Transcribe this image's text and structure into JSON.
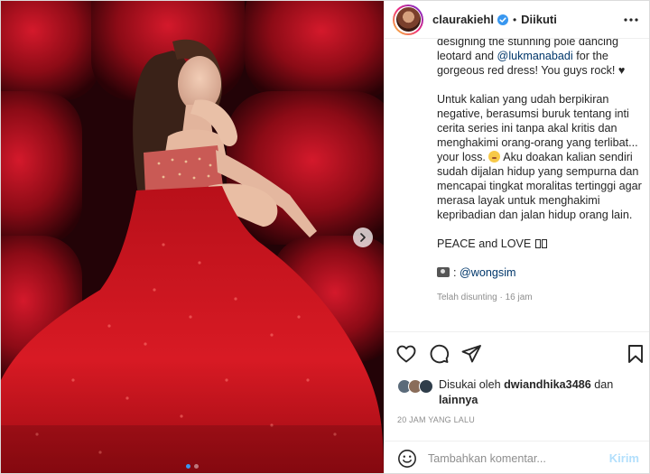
{
  "header": {
    "username": "claurakiehl",
    "separator": "•",
    "follow_state": "Diikuti"
  },
  "caption": {
    "line_clipped": "designing the stunning pole dancing leotard and",
    "mention_1": "@lukmanabadi",
    "line_after_mention": " for the gorgeous red dress! You guys rock! ♥",
    "paragraph_2a": "Untuk kalian yang udah berpikiran negative, berasumsi buruk tentang inti cerita series ini tanpa akal kritis dan menghakimi orang-orang yang terlibat... your loss.",
    "paragraph_2b": " Aku doakan kalian sendiri sudah dijalan hidup yang sempurna dan mencapai tingkat moralitas tertinggi agar merasa layak untuk menghakimi kepribadian dan jalan hidup orang lain.",
    "paragraph_3": "PEACE and LOVE",
    "mention_2": "@wongsim",
    "edited": "Telah disunting · 16 jam"
  },
  "likes": {
    "prefix": "Disukai oleh ",
    "user": "dwiandhika3486",
    "middle": " dan ",
    "rest": "lainnya"
  },
  "time_ago": "20 JAM YANG LALU",
  "comment": {
    "placeholder": "Tambahkan komentar...",
    "send_label": "Kirim"
  },
  "carousel": {
    "total": 2,
    "active_index": 1
  },
  "icons": {
    "verified": "verified-badge-icon",
    "more": "more-options-icon",
    "like": "heart-icon",
    "comment": "comment-icon",
    "share": "share-icon",
    "save": "bookmark-icon",
    "emoji": "emoji-icon",
    "next": "chevron-right-icon"
  },
  "colors": {
    "verified_blue": "#3897f0",
    "link_blue": "#00376b",
    "muted": "#8e8e8e",
    "send_disabled": "#b2dffc",
    "dress_red": "#c8141e"
  }
}
